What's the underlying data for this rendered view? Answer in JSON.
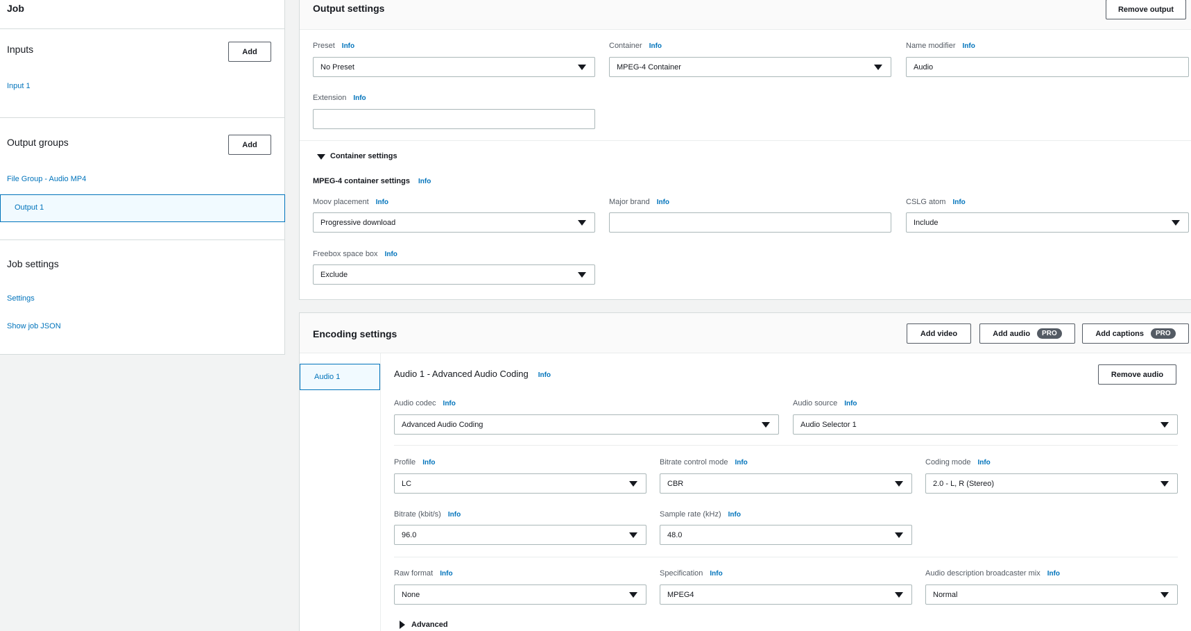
{
  "left": {
    "job_title": "Job",
    "inputs_title": "Inputs",
    "inputs_add": "Add",
    "input1": "Input 1",
    "output_groups_title": "Output groups",
    "output_groups_add": "Add",
    "file_group": "File Group - Audio MP4",
    "output1": "Output 1",
    "job_settings_title": "Job settings",
    "settings_link": "Settings",
    "show_json_link": "Show job JSON"
  },
  "output_settings": {
    "title": "Output settings",
    "remove_output": "Remove output",
    "info": "Info",
    "preset": {
      "label": "Preset",
      "value": "No Preset"
    },
    "container": {
      "label": "Container",
      "value": "MPEG-4 Container"
    },
    "name_modifier": {
      "label": "Name modifier",
      "value": "Audio"
    },
    "extension": {
      "label": "Extension",
      "value": ""
    },
    "container_settings": "Container settings",
    "mpeg4_settings": "MPEG-4 container settings",
    "moov": {
      "label": "Moov placement",
      "value": "Progressive download"
    },
    "major_brand": {
      "label": "Major brand",
      "value": ""
    },
    "cslg": {
      "label": "CSLG atom",
      "value": "Include"
    },
    "freebox": {
      "label": "Freebox space box",
      "value": "Exclude"
    }
  },
  "encoding": {
    "title": "Encoding settings",
    "add_video": "Add video",
    "add_audio": "Add audio",
    "add_captions": "Add captions",
    "pro": "PRO",
    "audio_tab": "Audio 1",
    "audio_heading": "Audio 1 - Advanced Audio Coding",
    "remove_audio": "Remove audio",
    "info": "Info",
    "audio_codec": {
      "label": "Audio codec",
      "value": "Advanced Audio Coding"
    },
    "audio_source": {
      "label": "Audio source",
      "value": "Audio Selector 1"
    },
    "profile": {
      "label": "Profile",
      "value": "LC"
    },
    "bitrate_mode": {
      "label": "Bitrate control mode",
      "value": "CBR"
    },
    "coding_mode": {
      "label": "Coding mode",
      "value": "2.0 - L, R (Stereo)"
    },
    "bitrate": {
      "label": "Bitrate (kbit/s)",
      "value": "96.0"
    },
    "sample_rate": {
      "label": "Sample rate (kHz)",
      "value": "48.0"
    },
    "raw_format": {
      "label": "Raw format",
      "value": "None"
    },
    "specification": {
      "label": "Specification",
      "value": "MPEG4"
    },
    "ad_mix": {
      "label": "Audio description broadcaster mix",
      "value": "Normal"
    },
    "advanced": "Advanced"
  },
  "colors": {
    "accent": "#0073bb",
    "selected_bg": "#f1faff",
    "border": "#d5dbdb"
  }
}
